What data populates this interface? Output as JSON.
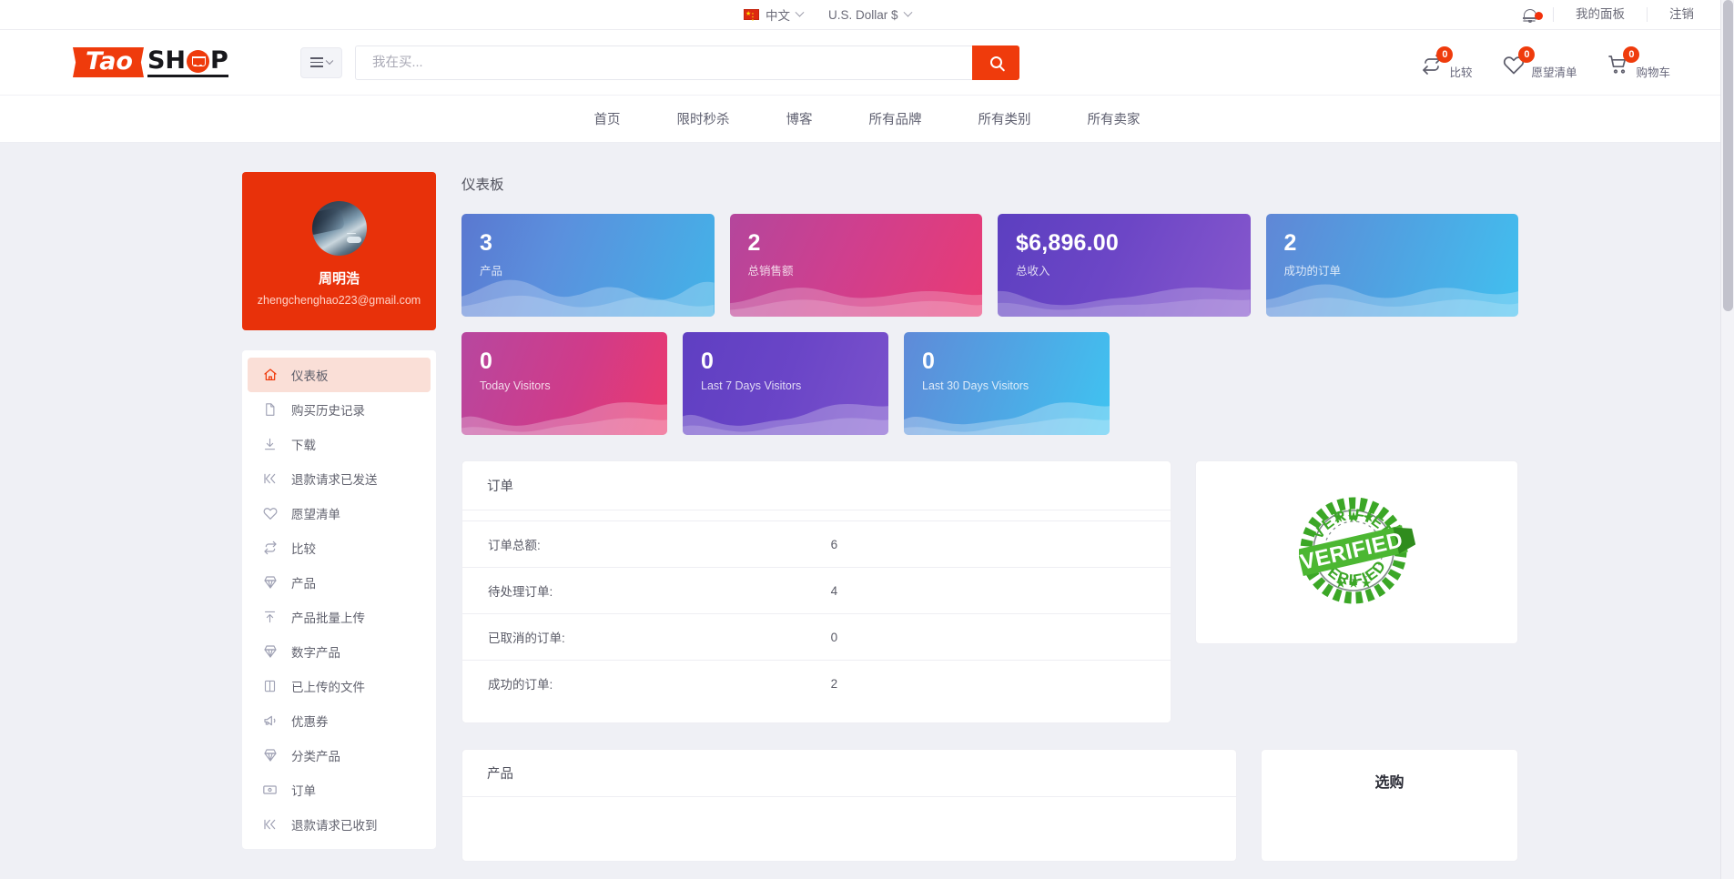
{
  "topbar": {
    "language": "中文",
    "language_flag_icon": "flag-cn-icon",
    "currency": "U.S. Dollar $",
    "notification_icon": "bell-icon",
    "my_panel": "我的面板",
    "logout": "注销"
  },
  "header": {
    "logo_part1": "Tao",
    "logo_part2a": "SH",
    "logo_part2b": "P",
    "logo_cart_icon": "shopping-cart-icon",
    "category_button_icon": "hamburger-icon",
    "search_placeholder": "我在买...",
    "search_value": "",
    "search_icon": "magnifier-icon",
    "actions": [
      {
        "icon": "compare-icon",
        "label": "比较",
        "count": "0"
      },
      {
        "icon": "heart-icon",
        "label": "愿望清单",
        "count": "0"
      },
      {
        "icon": "cart-icon",
        "label": "购物车",
        "count": "0"
      }
    ]
  },
  "nav": {
    "items": [
      "首页",
      "限时秒杀",
      "博客",
      "所有品牌",
      "所有类别",
      "所有卖家"
    ]
  },
  "sidebar": {
    "profile": {
      "avatar_icon": "user-avatar",
      "name": "周明浩",
      "email": "zhengchenghao223@gmail.com"
    },
    "items": [
      {
        "label": "仪表板",
        "icon": "home-icon",
        "active": true
      },
      {
        "label": "购买历史记录",
        "icon": "file-icon",
        "active": false
      },
      {
        "label": "下载",
        "icon": "download-icon",
        "active": false
      },
      {
        "label": "退款请求已发送",
        "icon": "refund-sent-icon",
        "active": false
      },
      {
        "label": "愿望清单",
        "icon": "heart-icon",
        "active": false
      },
      {
        "label": "比较",
        "icon": "compare-icon",
        "active": false
      },
      {
        "label": "产品",
        "icon": "diamond-icon",
        "active": false
      },
      {
        "label": "产品批量上传",
        "icon": "upload-icon",
        "active": false
      },
      {
        "label": "数字产品",
        "icon": "diamond-icon",
        "active": false
      },
      {
        "label": "已上传的文件",
        "icon": "book-icon",
        "active": false
      },
      {
        "label": "优惠券",
        "icon": "megaphone-icon",
        "active": false
      },
      {
        "label": "分类产品",
        "icon": "diamond-icon",
        "active": false
      },
      {
        "label": "订单",
        "icon": "money-icon",
        "active": false
      },
      {
        "label": "退款请求已收到",
        "icon": "refund-received-icon",
        "active": false
      }
    ]
  },
  "main": {
    "page_title": "仪表板",
    "stats_row1": [
      {
        "value": "3",
        "label": "产品",
        "theme": "g-blue"
      },
      {
        "value": "2",
        "label": "总销售额",
        "theme": "g-pink"
      },
      {
        "value": "$6,896.00",
        "label": "总收入",
        "theme": "g-purple"
      },
      {
        "value": "2",
        "label": "成功的订单",
        "theme": "g-blue2"
      }
    ],
    "stats_row2": [
      {
        "value": "0",
        "label": "Today Visitors",
        "theme": "g-pink2"
      },
      {
        "value": "0",
        "label": "Last 7 Days Visitors",
        "theme": "g-purple2"
      },
      {
        "value": "0",
        "label": "Last 30 Days Visitors",
        "theme": "g-blue3"
      }
    ],
    "orders_panel": {
      "title": "订单",
      "rows": [
        {
          "label": "订单总额:",
          "value": "6"
        },
        {
          "label": "待处理订单:",
          "value": "4"
        },
        {
          "label": "已取消的订单:",
          "value": "0"
        },
        {
          "label": "成功的订单:",
          "value": "2"
        }
      ]
    },
    "verified_panel": {
      "stamp_icon": "verified-stamp-icon",
      "stamp_text": "VERIFIED",
      "stamp_color": "#3ba726"
    },
    "products_panel": {
      "title": "产品"
    },
    "shop_panel": {
      "title": "选购"
    }
  },
  "colors": {
    "brand": "#ef3b0c",
    "profile_card": "#e8310a",
    "page_bg": "#eff0f5",
    "active_menu_bg": "#fadfd7"
  }
}
